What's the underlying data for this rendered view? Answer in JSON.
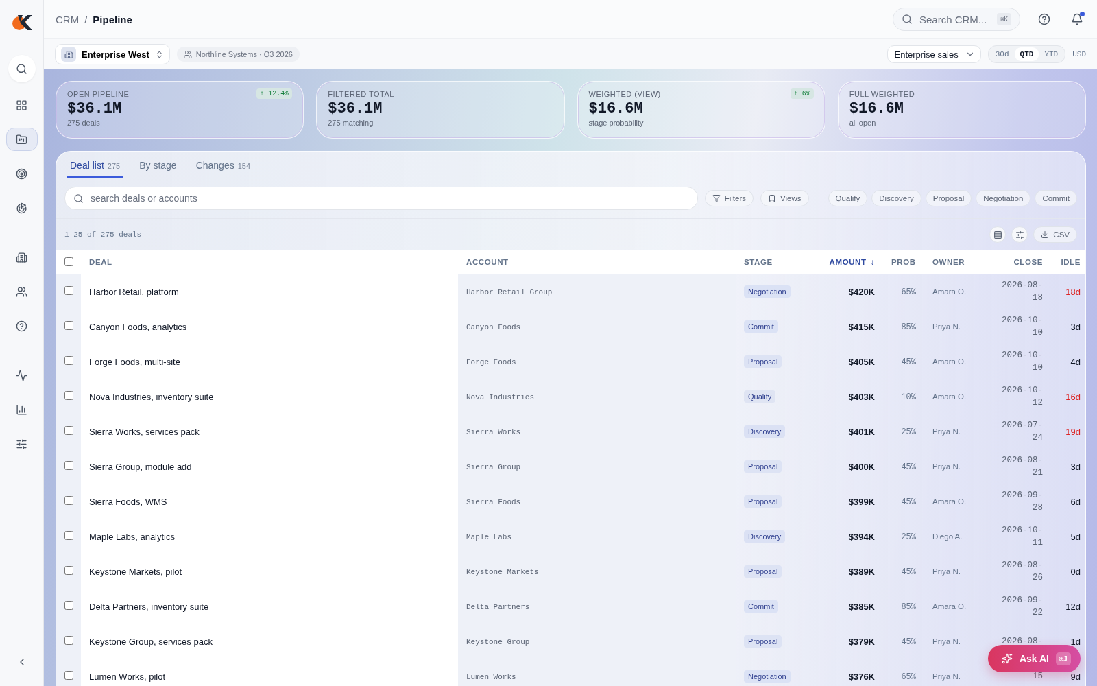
{
  "breadcrumb": {
    "parent": "CRM",
    "separator": "/",
    "current": "Pipeline"
  },
  "search": {
    "placeholder": "Search CRM...",
    "shortcut": "⌘K"
  },
  "notifications": {
    "unread": true
  },
  "sidebar": {
    "items": [
      {
        "selected": false
      },
      {
        "selected": false
      },
      {
        "selected": true
      },
      {
        "selected": false
      },
      {
        "selected": false
      },
      {
        "selected": false
      },
      {
        "selected": false
      },
      {
        "selected": false
      },
      {
        "selected": false
      },
      {
        "selected": false
      },
      {
        "selected": false
      }
    ]
  },
  "workspace": {
    "name": "Enterprise West",
    "context": "Northline Systems · Q3 2026"
  },
  "view_select": {
    "value": "Enterprise sales"
  },
  "periods": [
    {
      "label": "30d",
      "selected": false
    },
    {
      "label": "QTD",
      "selected": true
    },
    {
      "label": "YTD",
      "selected": false
    }
  ],
  "currency": "USD",
  "kpis": [
    {
      "label": "OPEN PIPELINE",
      "value": "$36.1M",
      "sub": "275 deals",
      "delta": "↑ 12.4%"
    },
    {
      "label": "FILTERED TOTAL",
      "value": "$36.1M",
      "sub": "275 matching"
    },
    {
      "label": "WEIGHTED (VIEW)",
      "value": "$16.6M",
      "sub": "stage probability",
      "delta": "↑ 6%"
    },
    {
      "label": "FULL WEIGHTED",
      "value": "$16.6M",
      "sub": "all open"
    }
  ],
  "tabs": [
    {
      "label": "Deal list",
      "count": "275",
      "selected": true
    },
    {
      "label": "By stage",
      "selected": false
    },
    {
      "label": "Changes",
      "count": "154",
      "selected": false
    }
  ],
  "deal_search": {
    "placeholder": "search deals or accounts"
  },
  "filters": [
    "Filters",
    "Views"
  ],
  "stage_chips": [
    "Qualify",
    "Discovery",
    "Proposal",
    "Negotiation",
    "Commit"
  ],
  "range": "1-25 of 275 deals",
  "export": "CSV",
  "table": {
    "all_checked": false,
    "columns": [
      {
        "label": "DEAL",
        "sorted": false
      },
      {
        "label": "ACCOUNT",
        "sorted": false
      },
      {
        "label": "STAGE",
        "sorted": false
      },
      {
        "label": "AMOUNT",
        "sorted": true
      },
      {
        "label": "PROB",
        "sorted": false
      },
      {
        "label": "OWNER",
        "sorted": false
      },
      {
        "label": "CLOSE",
        "sorted": false
      },
      {
        "label": "IDLE",
        "sorted": false
      }
    ],
    "sort_mark": "↓",
    "rows": [
      {
        "checked": false,
        "deal": "Harbor Retail, platform",
        "account": "Harbor Retail Group",
        "stage": "Negotiation",
        "amount": "$420K",
        "prob": "65%",
        "owner": "Amara O.",
        "close": "2026-08-18",
        "idle": "18d",
        "stale": true
      },
      {
        "checked": false,
        "deal": "Canyon Foods, analytics",
        "account": "Canyon Foods",
        "stage": "Commit",
        "amount": "$415K",
        "prob": "85%",
        "owner": "Priya N.",
        "close": "2026-10-10",
        "idle": "3d",
        "stale": false
      },
      {
        "checked": false,
        "deal": "Forge Foods, multi-site",
        "account": "Forge Foods",
        "stage": "Proposal",
        "amount": "$405K",
        "prob": "45%",
        "owner": "Amara O.",
        "close": "2026-10-10",
        "idle": "4d",
        "stale": false
      },
      {
        "checked": false,
        "deal": "Nova Industries, inventory suite",
        "account": "Nova Industries",
        "stage": "Qualify",
        "amount": "$403K",
        "prob": "10%",
        "owner": "Amara O.",
        "close": "2026-10-12",
        "idle": "16d",
        "stale": true
      },
      {
        "checked": false,
        "deal": "Sierra Works, services pack",
        "account": "Sierra Works",
        "stage": "Discovery",
        "amount": "$401K",
        "prob": "25%",
        "owner": "Priya N.",
        "close": "2026-07-24",
        "idle": "19d",
        "stale": true
      },
      {
        "checked": false,
        "deal": "Sierra Group, module add",
        "account": "Sierra Group",
        "stage": "Proposal",
        "amount": "$400K",
        "prob": "45%",
        "owner": "Priya N.",
        "close": "2026-08-21",
        "idle": "3d",
        "stale": false
      },
      {
        "checked": false,
        "deal": "Sierra Foods, WMS",
        "account": "Sierra Foods",
        "stage": "Proposal",
        "amount": "$399K",
        "prob": "45%",
        "owner": "Amara O.",
        "close": "2026-09-28",
        "idle": "6d",
        "stale": false
      },
      {
        "checked": false,
        "deal": "Maple Labs, analytics",
        "account": "Maple Labs",
        "stage": "Discovery",
        "amount": "$394K",
        "prob": "25%",
        "owner": "Diego A.",
        "close": "2026-10-11",
        "idle": "5d",
        "stale": false
      },
      {
        "checked": false,
        "deal": "Keystone Markets, pilot",
        "account": "Keystone Markets",
        "stage": "Proposal",
        "amount": "$389K",
        "prob": "45%",
        "owner": "Priya N.",
        "close": "2026-08-26",
        "idle": "0d",
        "stale": false
      },
      {
        "checked": false,
        "deal": "Delta Partners, inventory suite",
        "account": "Delta Partners",
        "stage": "Commit",
        "amount": "$385K",
        "prob": "85%",
        "owner": "Amara O.",
        "close": "2026-09-22",
        "idle": "12d",
        "stale": false
      },
      {
        "checked": false,
        "deal": "Keystone Group, services pack",
        "account": "Keystone Group",
        "stage": "Proposal",
        "amount": "$379K",
        "prob": "45%",
        "owner": "Priya N.",
        "close": "2026-08-",
        "idle": "1d",
        "stale": false
      },
      {
        "checked": false,
        "deal": "Lumen Works, pilot",
        "account": "Lumen Works",
        "stage": "Negotiation",
        "amount": "$376K",
        "prob": "65%",
        "owner": "Priya N.",
        "close": "15",
        "idle": "9d",
        "stale": false
      }
    ]
  },
  "ask_ai": {
    "label": "Ask AI",
    "shortcut": "⌘J"
  }
}
